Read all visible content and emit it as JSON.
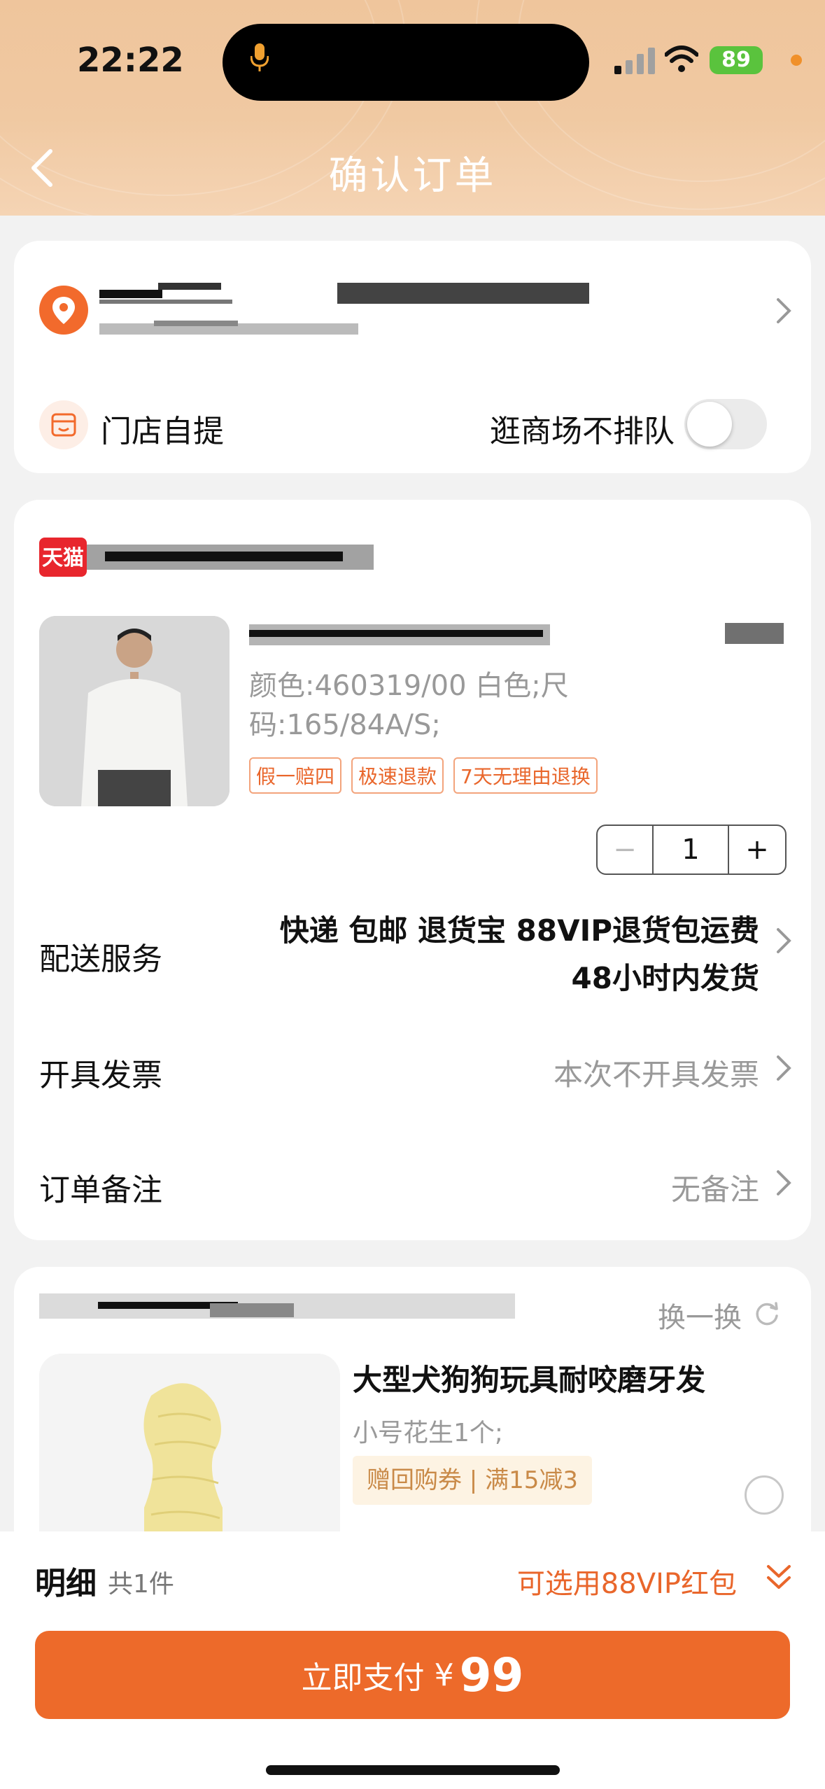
{
  "status": {
    "time": "22:22",
    "battery": "89"
  },
  "header": {
    "title": "确认订单"
  },
  "address": {
    "store_pickup": "门店自提",
    "mall_no_queue": "逛商场不排队",
    "mall_no_queue_on": false
  },
  "shop": {
    "logo": "天猫",
    "product": {
      "spec": "颜色:460319/00 白色;尺码:165/84A/S;",
      "tags": [
        "假一赔四",
        "极速退款",
        "7天无理由退换"
      ],
      "quantity": "1"
    },
    "delivery": {
      "label": "配送服务",
      "line1": "快递 包邮 退货宝 88VIP退货包运费",
      "line2": "48小时内发货"
    },
    "invoice": {
      "label": "开具发票",
      "value": "本次不开具发票"
    },
    "note": {
      "label": "订单备注",
      "value": "无备注"
    }
  },
  "recommend": {
    "swap_label": "换一换",
    "product_name": "大型犬狗狗玩具耐咬磨牙发",
    "spec": "小号花生1个;",
    "coupon": "赠回购券 | 满15减3"
  },
  "bottom": {
    "detail_label": "明细",
    "count_label": "共1件",
    "vip_label": "可选用88VIP红包",
    "pay_label": "立即支付",
    "currency": "¥",
    "amount": "99"
  },
  "colors": {
    "accent": "#ed6a2a",
    "tmall_red": "#e8262d",
    "header_bg": "#efc59c"
  },
  "icons": [
    "back-icon",
    "mic-icon",
    "signal-icon",
    "wifi-icon",
    "location-icon",
    "store-icon",
    "chevron-right-icon",
    "refresh-icon",
    "chevron-down-icon"
  ]
}
